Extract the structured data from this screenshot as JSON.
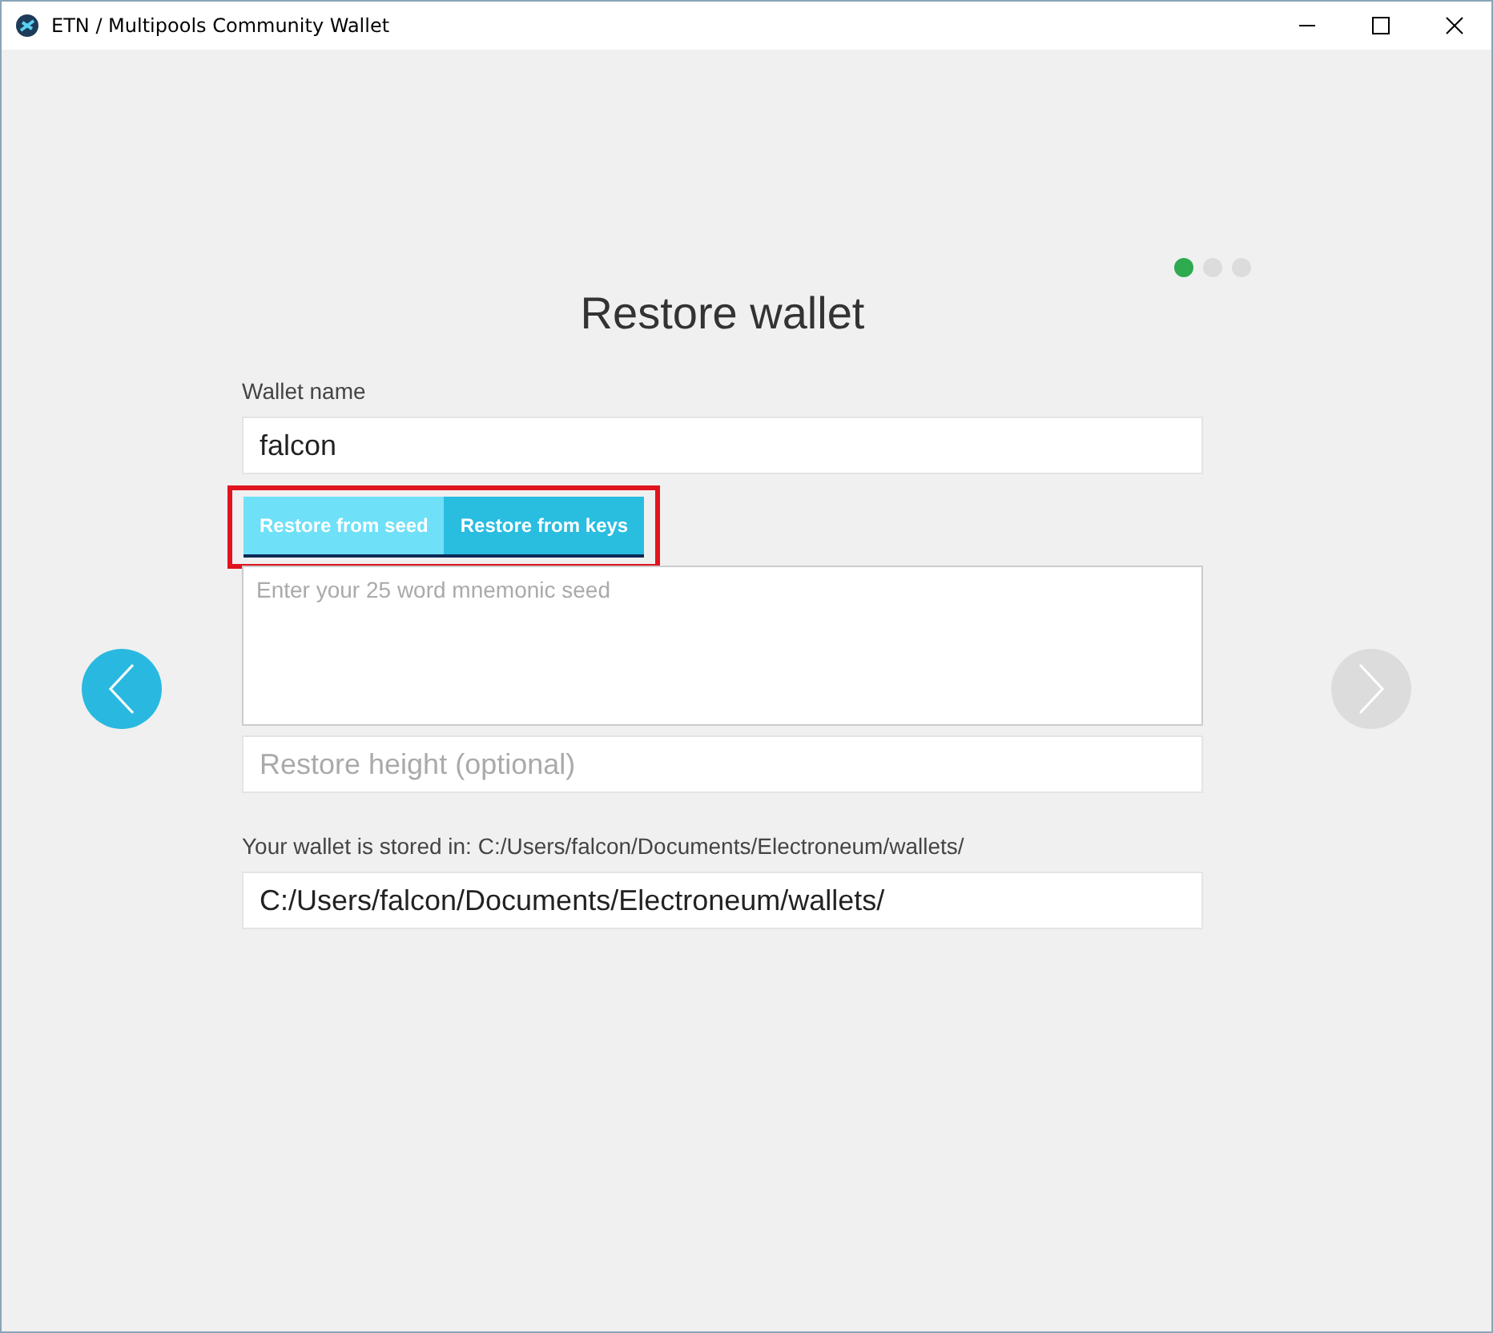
{
  "window": {
    "title": "ETN / Multipools Community Wallet"
  },
  "steps": [
    {
      "selected": true
    },
    {
      "selected": false
    },
    {
      "selected": false
    }
  ],
  "heading": "Restore wallet",
  "wallet_name": {
    "label": "Wallet name",
    "value": "falcon"
  },
  "restore_tabs": {
    "highlighted": true,
    "tabs": [
      {
        "label": "Restore from seed",
        "selected": true
      },
      {
        "label": "Restore from keys",
        "selected": false
      }
    ]
  },
  "seed": {
    "placeholder": "Enter your 25 word mnemonic seed"
  },
  "restore_height": {
    "placeholder": "Restore height (optional)"
  },
  "location": {
    "label": "Your wallet is stored in: C:/Users/falcon/Documents/Electroneum/wallets/",
    "value": "C:/Users/falcon/Documents/Electroneum/wallets/"
  },
  "nav": {
    "back_disabled": false,
    "next_disabled": true
  }
}
